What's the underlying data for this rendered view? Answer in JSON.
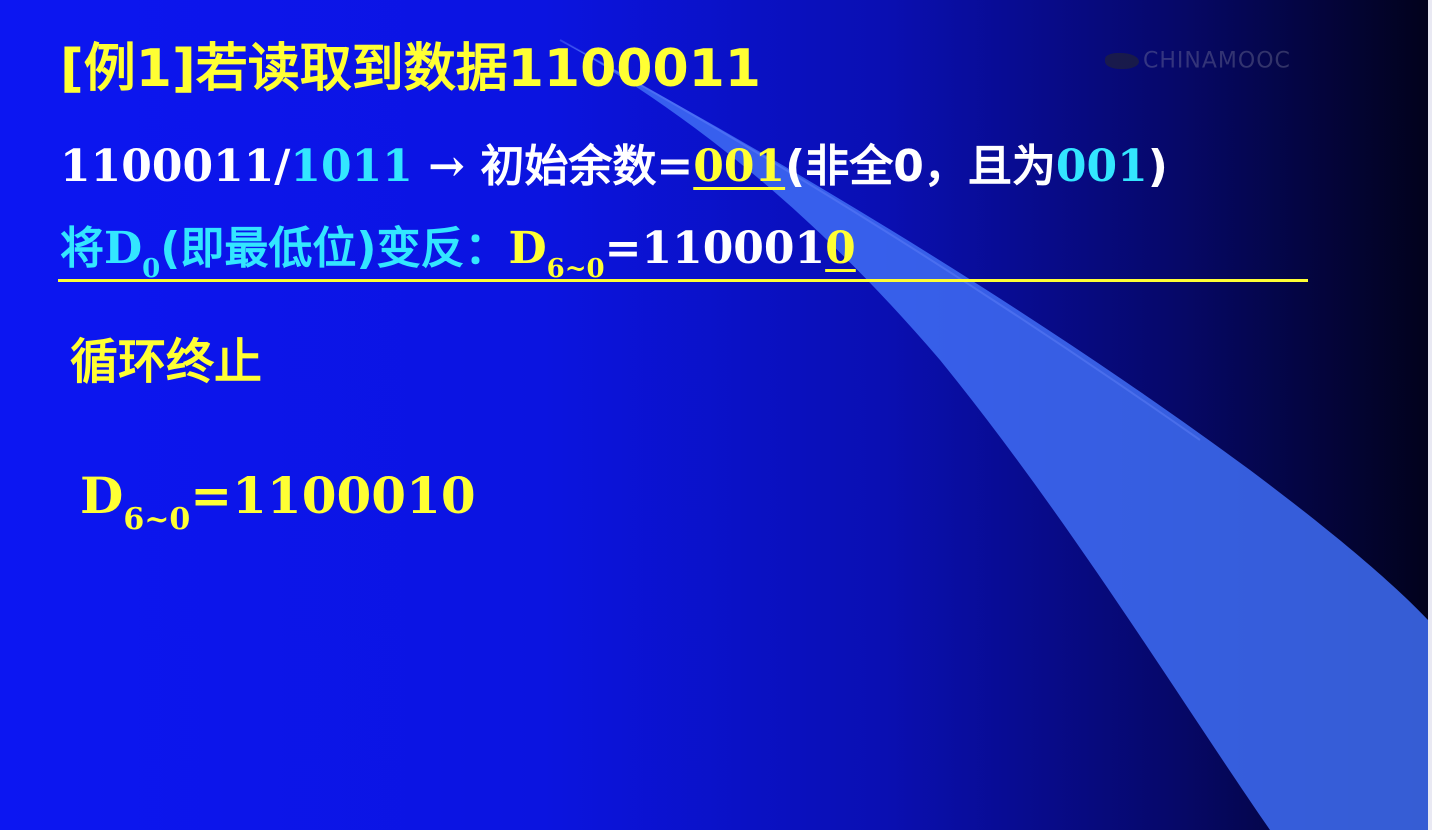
{
  "slide": {
    "title": "[例1]若读取到数据1100011",
    "line2": {
      "dividend": "1100011/",
      "divisor": "1011",
      "arrow": " → ",
      "label": "初始余数=",
      "remainder": "001",
      "note_open": "(非全0，且为",
      "note_value": "001",
      "note_close": ")"
    },
    "line3": {
      "prefix": "将D",
      "sub0": "0",
      "mid": "(即最低位)变反：",
      "D": "D",
      "sub_range": "6~0",
      "eq": "=110001",
      "flipped_bit": "0"
    },
    "line4": "循环终止",
    "line5": {
      "D": "D",
      "sub_range": "6~0",
      "value": "=1100010"
    }
  },
  "watermark": "CHINAMOOC",
  "colors": {
    "background_left": "#0c16f2",
    "background_right": "#02021c",
    "title": "#ffff33",
    "accent_cyan": "#33e6ff",
    "body_white": "#ffffff",
    "swoosh": "#3f6df5"
  }
}
